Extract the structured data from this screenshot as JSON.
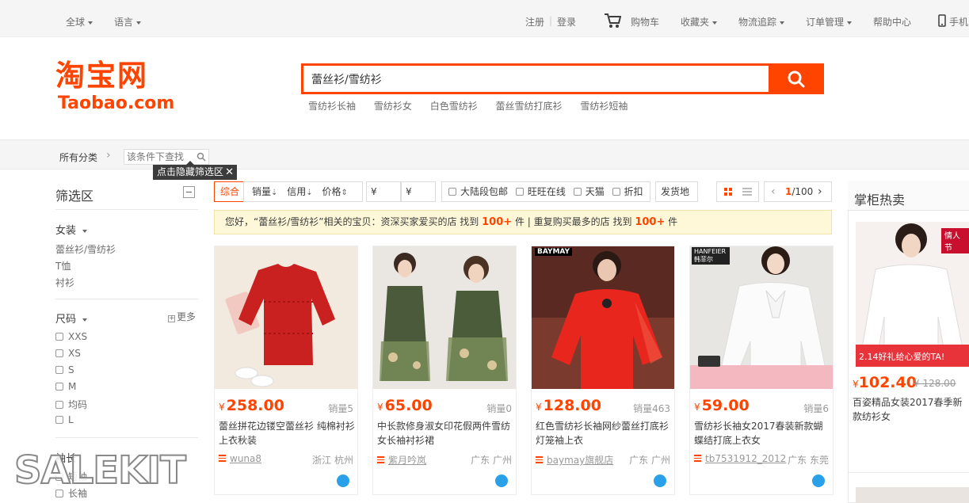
{
  "topbar": {
    "global": "全球",
    "language": "语言",
    "register": "注册",
    "login": "登录",
    "cart": "购物车",
    "favorites": "收藏夹",
    "logistics": "物流追踪",
    "orders": "订单管理",
    "help": "帮助中心",
    "mobile": "手机"
  },
  "header": {
    "logo_cn": "淘宝网",
    "logo_en": "Taobao.com",
    "search_value": "蕾丝衫/雪纺衫",
    "hot_words": [
      "雪纺衫长袖",
      "雪纺衫女",
      "白色雪纺衫",
      "蕾丝雪纺打底衫",
      "雪纺衫短袖"
    ],
    "accent": "#ff4400"
  },
  "crumb": {
    "all_categories": "所有分类",
    "filter_placeholder": "该条件下查找",
    "tip": "点击隐藏筛选区"
  },
  "filter": {
    "title": "筛选区",
    "category_head": "女装",
    "category_links": [
      "蕾丝衫/雪纺衫",
      "T恤",
      "衬衫"
    ],
    "size_head": "尺码",
    "size_more": "更多",
    "sizes": [
      "XXS",
      "XS",
      "S",
      "M",
      "均码",
      "L"
    ],
    "sleeve_head": "袖长",
    "sleeves": [
      "短袖",
      "长袖"
    ]
  },
  "sortbar": {
    "overall": "综合",
    "sales": "销量",
    "credit": "信用",
    "price": "价格",
    "price_from": "¥",
    "price_to": "¥",
    "free_shipping": "大陆段包邮",
    "wangwang": "旺旺在线",
    "tmall": "天猫",
    "discount": "折扣",
    "ship_from": "发货地",
    "page": "1",
    "page_total": "/100"
  },
  "notice": {
    "prefix": "您好，“蕾丝衫/雪纺衫”相关的宝贝：资深买家爱买的店 找到",
    "count1": "100+",
    "middle": "件 | 重复购买最多的店 找到",
    "count2": "100+",
    "suffix": "件"
  },
  "products": [
    {
      "currency": "¥",
      "price": "258.00",
      "sales": "销量5",
      "title": "蕾丝拼花边镂空蕾丝衫 纯棉衬衫上衣秋装",
      "shop": "wuna8",
      "location": "浙江 杭州"
    },
    {
      "currency": "¥",
      "price": "65.00",
      "sales": "销量0",
      "title": "中长款修身淑女印花假两件雪纺女长袖衬衫裙",
      "shop": "紫月吟岚",
      "location": "广东 广州"
    },
    {
      "currency": "¥",
      "price": "128.00",
      "sales": "销量463",
      "title": "红色雪纺衫长袖网纱蕾丝打底衫灯笼袖上衣",
      "shop": "baymay旗舰店",
      "location": "广东 广州",
      "brand": "BAYMAY"
    },
    {
      "currency": "¥",
      "price": "59.00",
      "sales": "销量6",
      "title": "雪纺衫长袖女2017春装新款蝴蝶结打底上衣女",
      "shop": "tb7531912_2012",
      "location": "广东 东莞",
      "brand": "HANFEIER 韩菲尔"
    }
  ],
  "hot": {
    "title": "掌柜热卖",
    "currency": "¥",
    "price": "102.40",
    "old_price": "¥ 128.00",
    "desc": "百姿精品女装2017春季新款纺衫女",
    "banner_top": "情人节",
    "banner_bottom": "2.14好礼给心爱的TA!"
  },
  "watermark": "SALEKIT"
}
